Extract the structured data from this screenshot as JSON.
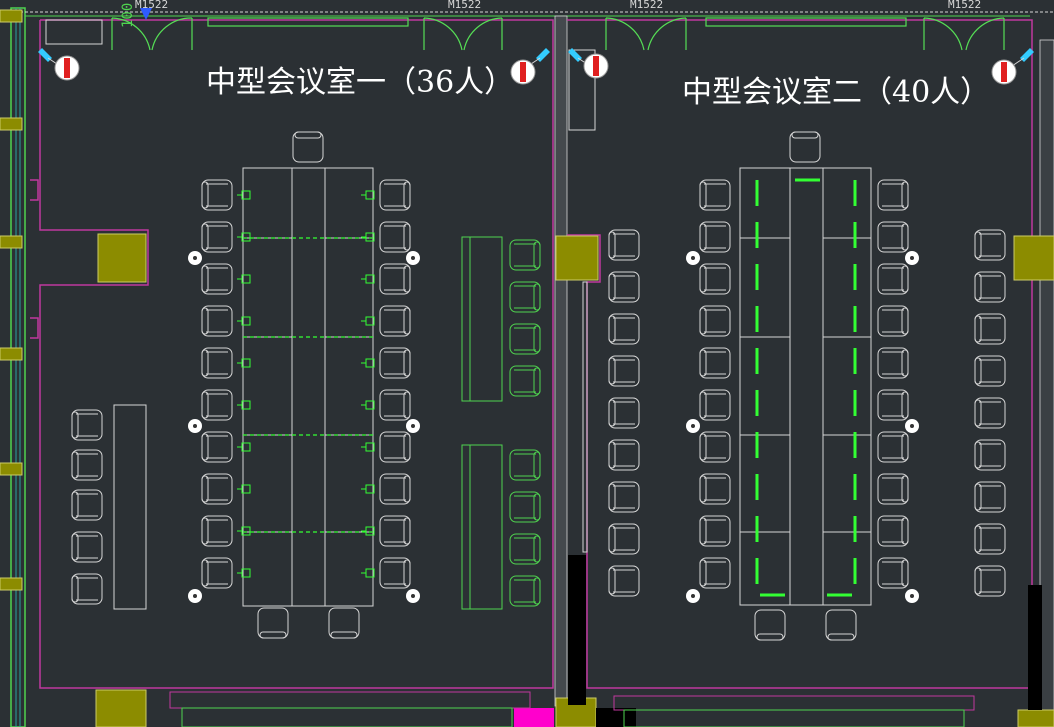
{
  "colors": {
    "background": "#2b3034",
    "wall": "#c0389e",
    "fixture": "#4fd34f",
    "furniture": "#d6d6d6",
    "column": "#8c8c00",
    "bright_green": "#33ff33",
    "door": "#55dd55",
    "magenta_block": "#ff00cc"
  },
  "rooms": [
    {
      "id": "room-1",
      "title": "中型会议室一（36人）"
    },
    {
      "id": "room-2",
      "title": "中型会议室二（40人）"
    }
  ],
  "door_labels": [
    "M1522",
    "M1522",
    "M1522",
    "M1522"
  ],
  "dimension_label": "100",
  "icons": {
    "camera": "camera-icon",
    "fire_alarm": "fire-alarm-icon",
    "socket": "floor-socket-icon",
    "chair": "chair-icon"
  }
}
